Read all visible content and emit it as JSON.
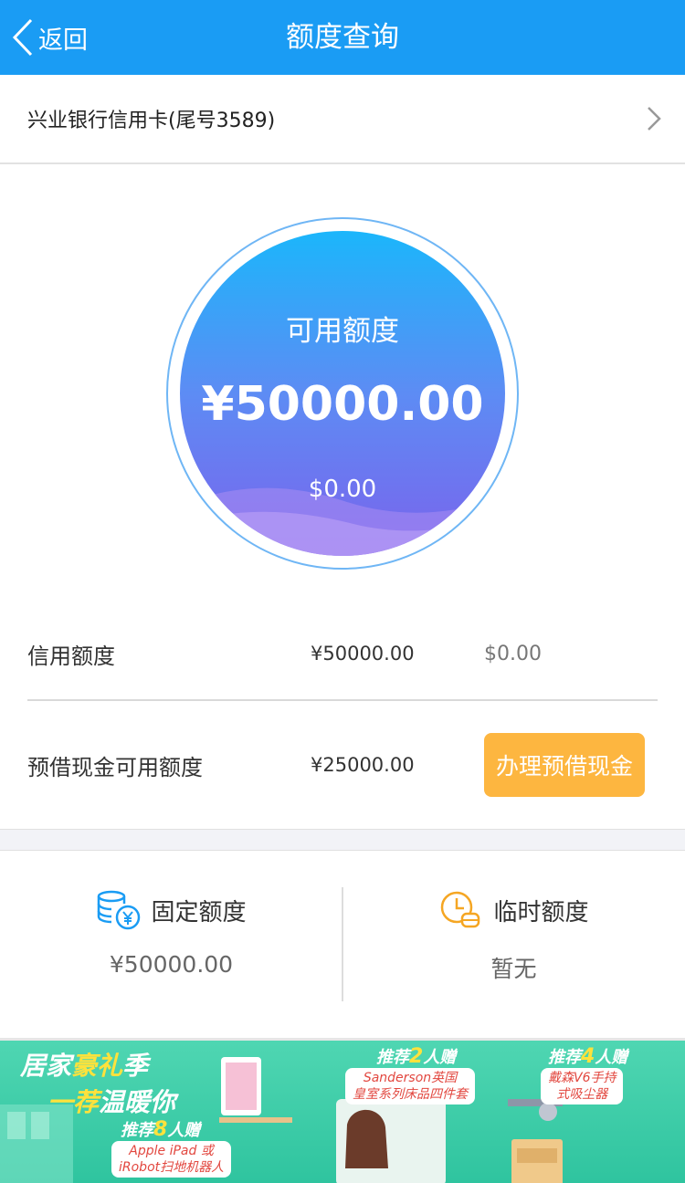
{
  "nav": {
    "back_label": "返回",
    "title": "额度查询"
  },
  "card": {
    "name": "兴业银行信用卡(尾号3589)"
  },
  "circle": {
    "label": "可用额度",
    "amount": "¥50000.00",
    "usd": "$0.00"
  },
  "credit": {
    "label": "信用额度",
    "cny": "¥50000.00",
    "usd": "$0.00"
  },
  "cash": {
    "label": "预借现金可用额度",
    "cny": "¥25000.00",
    "button": "办理预借现金"
  },
  "fixed": {
    "label": "固定额度",
    "value": "¥50000.00"
  },
  "temp": {
    "label": "临时额度",
    "value": "暂无"
  },
  "banner": {
    "title1_a": "居家",
    "title1_b": "豪礼",
    "title1_c": "季",
    "title2_a": "一荐",
    "title2_b": "温暖你",
    "rec8_a": "推荐",
    "rec8_n": "8",
    "rec8_b": "人赠",
    "prize8_line1": "Apple iPad 或",
    "prize8_line2": "iRobot扫地机器人",
    "rec2_a": "推荐",
    "rec2_n": "2",
    "rec2_b": "人赠",
    "prize2_line1": "Sanderson英国",
    "prize2_line2": "皇室系列床品四件套",
    "rec4_a": "推荐",
    "rec4_n": "4",
    "rec4_b": "人赠",
    "prize4_line1": "戴森V6手持",
    "prize4_line2": "式吸尘器"
  },
  "colors": {
    "nav": "#1a9cf4",
    "button": "#fdb640",
    "circle_top": "#1bb6fb",
    "circle_bottom": "#7a63ec",
    "banner": "#3ecba8"
  },
  "icons": {
    "back": "chevron-left-icon",
    "card_arrow": "chevron-right-icon",
    "fixed": "coins-yen-icon",
    "temp": "clock-coin-icon"
  }
}
